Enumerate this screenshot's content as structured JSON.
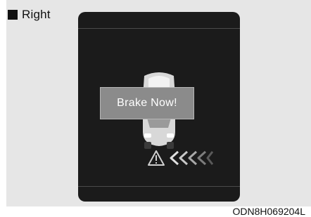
{
  "caption": {
    "label": "Right"
  },
  "display": {
    "popup_text": "Brake Now!",
    "icons": {
      "vehicle": "car-rear-icon",
      "warning": "warning-triangle-icon",
      "approach": "chevron-left-icon"
    }
  },
  "figure_code": "ODN8H069204L",
  "colors": {
    "screen": "#1b1b1b",
    "popup": "#8b8b8b",
    "panel": "#e6e6e6"
  }
}
